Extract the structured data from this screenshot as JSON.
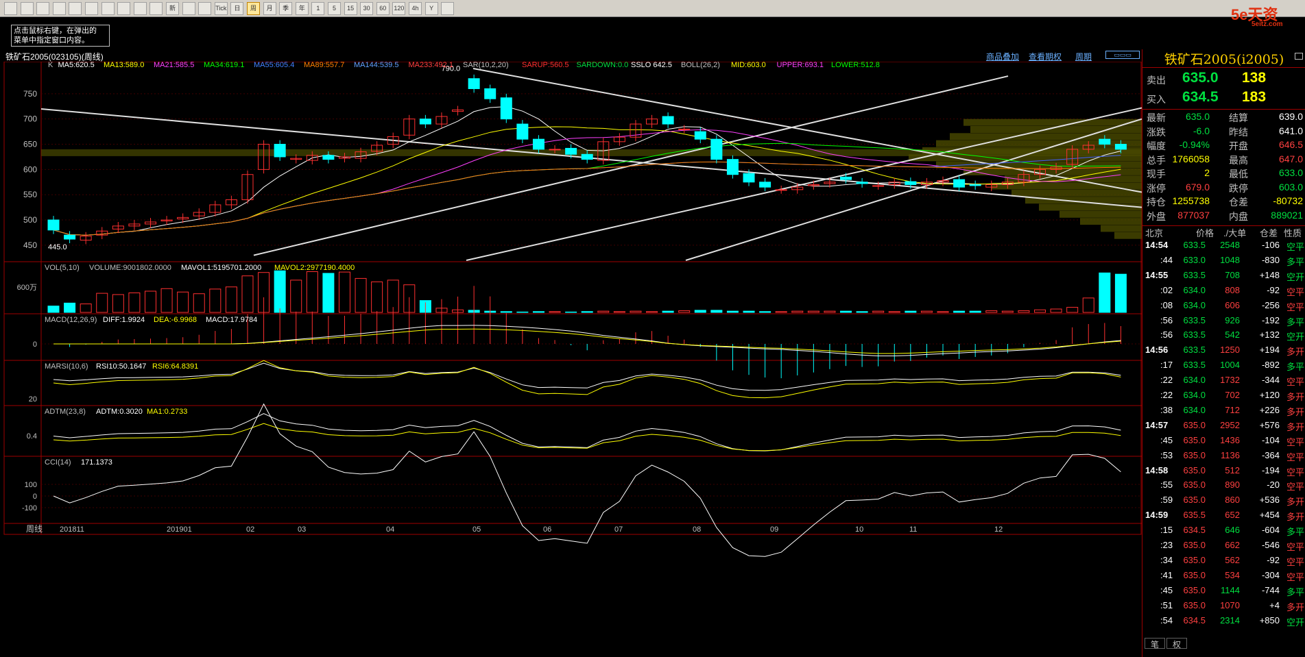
{
  "toolbar": {
    "icons": [
      "home-icon",
      "back-icon",
      "news-icon",
      "refresh-icon",
      "zoom-in-icon",
      "zoom-out-icon",
      "search-icon",
      "pen-icon",
      "pencil-icon",
      "filter-icon",
      "new-icon",
      "list-icon",
      "trend-icon",
      "tick-icon",
      "day-icon",
      "week-icon",
      "month-icon",
      "season-icon",
      "year-icon",
      "1min-icon",
      "5min-icon",
      "15min-icon",
      "30min-icon",
      "60min-icon",
      "120min-icon",
      "4hour-icon",
      "multi-day-icon",
      "calendar-icon"
    ],
    "labels": [
      "",
      "",
      "",
      "",
      "",
      "",
      "",
      "",
      "",
      "",
      "新",
      "",
      "",
      "Tick",
      "日",
      "周",
      "月",
      "季",
      "年",
      "1",
      "5",
      "15",
      "30",
      "60",
      "120",
      "4h",
      "Y",
      ""
    ]
  },
  "logo": {
    "text": "5e天资",
    "sub": "5eitz.com"
  },
  "hint": {
    "line1": "点击鼠标右键，在弹出的",
    "line2": "菜单中指定窗口内容。"
  },
  "chart": {
    "title": "铁矿石2005(023105)(周线)",
    "links": [
      "商品叠加",
      "查看期权",
      "周期"
    ],
    "indicator_line": {
      "k": "K",
      "ma5": "MA5:620.5",
      "ma13": "MA13:589.0",
      "ma21": "MA21:585.5",
      "ma34": "MA34:619.1",
      "ma55": "MA55:605.4",
      "ma89": "MA89:557.7",
      "ma144": "MA144:539.5",
      "ma233": "MA233:492.1",
      "sar": "SAR(10,2,20)",
      "sarup": "SARUP:560.5",
      "sardown": "SARDOWN:0.0",
      "sslo": "SSLO 642.5",
      "boll": "BOLL(26,2)",
      "mid": "MID:603.0",
      "upper": "UPPER:693.1",
      "lower": "LOWER:512.8"
    },
    "price_labels": {
      "high": "790.0",
      "low": "445.0"
    },
    "y_ticks": [
      "750",
      "700",
      "650",
      "600",
      "550",
      "500",
      "450"
    ],
    "vol": {
      "header": "VOL(5,10)",
      "volume": "VOLUME:9001802.0000",
      "mavol1": "MAVOL1:5195701.2000",
      "mavol2": "MAVOL2:2977190.4000",
      "tick": "600万"
    },
    "macd": {
      "header": "MACD(12,26,9)",
      "diff": "DIFF:1.9924",
      "dea": "DEA:-6.9968",
      "macd": "MACD:17.9784",
      "tick": "0"
    },
    "marsi": {
      "header": "MARSI(10,6)",
      "rsi10": "RSI10:50.1647",
      "rsi6": "RSI6:64.8391",
      "tick": "20"
    },
    "adtm": {
      "header": "ADTM(23,8)",
      "adtm": "ADTM:0.3020",
      "ma1": "MA1:0.2733",
      "tick": "0.4"
    },
    "cci": {
      "header": "CCI(14)",
      "value": "171.1373",
      "ticks": [
        "100",
        "0",
        "-100"
      ]
    },
    "x_axis": {
      "label": "周线",
      "ticks": [
        "201811",
        "201901",
        "02",
        "03",
        "04",
        "05",
        "06",
        "07",
        "08",
        "09",
        "10",
        "11",
        "12"
      ]
    }
  },
  "chart_data": {
    "type": "candlestick",
    "ylim": [
      420,
      800
    ],
    "close": [
      480,
      462,
      468,
      478,
      488,
      492,
      496,
      500,
      505,
      515,
      530,
      540,
      590,
      650,
      625,
      622,
      628,
      620,
      625,
      635,
      648,
      665,
      700,
      690,
      705,
      718,
      760,
      740,
      700,
      660,
      640,
      640,
      630,
      620,
      655,
      664,
      690,
      700,
      690,
      680,
      660,
      620,
      590,
      575,
      565,
      560,
      565,
      570,
      575,
      580,
      572,
      568,
      575,
      570,
      575,
      578,
      565,
      568,
      570,
      575,
      590,
      600,
      605,
      640,
      648,
      650,
      640
    ],
    "open": [
      500,
      470,
      460,
      470,
      482,
      488,
      492,
      498,
      502,
      508,
      515,
      530,
      540,
      600,
      650,
      620,
      618,
      628,
      622,
      622,
      636,
      650,
      668,
      700,
      690,
      715,
      780,
      760,
      742,
      690,
      660,
      640,
      642,
      630,
      618,
      655,
      664,
      690,
      705,
      680,
      675,
      660,
      620,
      592,
      575,
      560,
      560,
      568,
      572,
      585,
      575,
      568,
      570,
      576,
      570,
      575,
      580,
      570,
      565,
      570,
      575,
      590,
      600,
      610,
      640,
      660,
      650
    ],
    "volume_mln": [
      1.5,
      2.2,
      2.0,
      4.5,
      4.2,
      4.6,
      5.0,
      5.6,
      4.8,
      4.4,
      5.5,
      6.0,
      8.6,
      9.4,
      9.8,
      7.6,
      9.6,
      9.2,
      9.5,
      8.0,
      7.2,
      7.6,
      6.5,
      2.8,
      1.0,
      0.6,
      0.5,
      0.3,
      0.2,
      0.1,
      0.2,
      0.2,
      0.1,
      0.2,
      0.3,
      0.2,
      0.3,
      0.2,
      0.3,
      0.4,
      0.5,
      0.5,
      0.3,
      0.3,
      0.2,
      0.2,
      0.3,
      0.3,
      0.3,
      0.3,
      0.2,
      0.3,
      0.2,
      0.3,
      0.3,
      0.2,
      0.3,
      0.3,
      0.4,
      0.3,
      0.4,
      0.6,
      0.8,
      1.2,
      3.4,
      9.3,
      9.0
    ]
  },
  "quote": {
    "title": "铁矿石2005(i2005)",
    "sell": {
      "label": "卖出",
      "price": "635.0",
      "vol": "138"
    },
    "buy": {
      "label": "买入",
      "price": "634.5",
      "vol": "183"
    },
    "rows": [
      {
        "l1": "最新",
        "v1": "635.0",
        "c1": "green",
        "l2": "结算",
        "v2": "639.0",
        "c2": "white"
      },
      {
        "l1": "涨跌",
        "v1": "-6.0",
        "c1": "green",
        "l2": "昨结",
        "v2": "641.0",
        "c2": "white"
      },
      {
        "l1": "幅度",
        "v1": "-0.94%",
        "c1": "green",
        "l2": "开盘",
        "v2": "646.5",
        "c2": "red"
      },
      {
        "l1": "总手",
        "v1": "1766058",
        "c1": "yellow",
        "l2": "最高",
        "v2": "647.0",
        "c2": "red"
      },
      {
        "l1": "现手",
        "v1": "2",
        "c1": "yellow",
        "l2": "最低",
        "v2": "633.0",
        "c2": "green"
      },
      {
        "l1": "涨停",
        "v1": "679.0",
        "c1": "red",
        "l2": "跌停",
        "v2": "603.0",
        "c2": "green"
      },
      {
        "l1": "持仓",
        "v1": "1255738",
        "c1": "yellow",
        "l2": "仓差",
        "v2": "-80732",
        "c2": "yellow"
      },
      {
        "l1": "外盘",
        "v1": "877037",
        "c1": "red",
        "l2": "内盘",
        "v2": "889021",
        "c2": "green"
      }
    ],
    "tick_header": {
      "city": "北京",
      "price": "价格",
      "vol": "./大单",
      "oi": "仓差",
      "type": "性质"
    },
    "ticks": [
      {
        "t": "14:54",
        "p": "633.5",
        "v": "2548",
        "oi": "-106",
        "k": "空平",
        "kc": "green"
      },
      {
        "t": ":44",
        "p": "633.0",
        "v": "1048",
        "oi": "-830",
        "k": "多平",
        "kc": "green"
      },
      {
        "t": "14:55",
        "p": "633.5",
        "v": "708",
        "oi": "+148",
        "k": "空开",
        "kc": "green"
      },
      {
        "t": ":02",
        "p": "634.0",
        "v": "808",
        "oi": "-92",
        "k": "空平",
        "kc": "red"
      },
      {
        "t": ":08",
        "p": "634.0",
        "v": "606",
        "oi": "-256",
        "k": "空平",
        "kc": "red"
      },
      {
        "t": ":56",
        "p": "633.5",
        "v": "926",
        "oi": "-192",
        "k": "多平",
        "kc": "green"
      },
      {
        "t": ":56",
        "p": "633.5",
        "v": "542",
        "oi": "+132",
        "k": "空开",
        "kc": "green"
      },
      {
        "t": "14:56",
        "p": "633.5",
        "v": "1250",
        "oi": "+194",
        "k": "多开",
        "kc": "red"
      },
      {
        "t": ":17",
        "p": "633.5",
        "v": "1004",
        "oi": "-892",
        "k": "多平",
        "kc": "green"
      },
      {
        "t": ":22",
        "p": "634.0",
        "v": "1732",
        "oi": "-344",
        "k": "空平",
        "kc": "red"
      },
      {
        "t": ":22",
        "p": "634.0",
        "v": "702",
        "oi": "+120",
        "k": "多开",
        "kc": "red"
      },
      {
        "t": ":38",
        "p": "634.0",
        "v": "712",
        "oi": "+226",
        "k": "多开",
        "kc": "red"
      },
      {
        "t": "14:57",
        "p": "635.0",
        "v": "2952",
        "oi": "+576",
        "k": "多开",
        "kc": "red"
      },
      {
        "t": ":45",
        "p": "635.0",
        "v": "1436",
        "oi": "-104",
        "k": "空平",
        "kc": "red"
      },
      {
        "t": ":53",
        "p": "635.0",
        "v": "1136",
        "oi": "-364",
        "k": "空平",
        "kc": "red"
      },
      {
        "t": "14:58",
        "p": "635.0",
        "v": "512",
        "oi": "-194",
        "k": "空平",
        "kc": "red"
      },
      {
        "t": ":55",
        "p": "635.0",
        "v": "890",
        "oi": "-20",
        "k": "空平",
        "kc": "red"
      },
      {
        "t": ":59",
        "p": "635.0",
        "v": "860",
        "oi": "+536",
        "k": "多开",
        "kc": "red"
      },
      {
        "t": "14:59",
        "p": "635.5",
        "v": "652",
        "oi": "+454",
        "k": "多开",
        "kc": "red"
      },
      {
        "t": ":15",
        "p": "634.5",
        "v": "646",
        "oi": "-604",
        "k": "多平",
        "kc": "green"
      },
      {
        "t": ":23",
        "p": "635.0",
        "v": "662",
        "oi": "-546",
        "k": "空平",
        "kc": "red"
      },
      {
        "t": ":34",
        "p": "635.0",
        "v": "562",
        "oi": "-92",
        "k": "空平",
        "kc": "red"
      },
      {
        "t": ":41",
        "p": "635.0",
        "v": "534",
        "oi": "-304",
        "k": "空平",
        "kc": "red"
      },
      {
        "t": ":45",
        "p": "635.0",
        "v": "1144",
        "oi": "-744",
        "k": "多平",
        "kc": "green"
      },
      {
        "t": ":51",
        "p": "635.0",
        "v": "1070",
        "oi": "+4",
        "k": "多开",
        "kc": "red"
      },
      {
        "t": ":54",
        "p": "634.5",
        "v": "2314",
        "oi": "+850",
        "k": "空开",
        "kc": "green"
      }
    ],
    "bottom_tabs": [
      "笔",
      "权"
    ]
  }
}
